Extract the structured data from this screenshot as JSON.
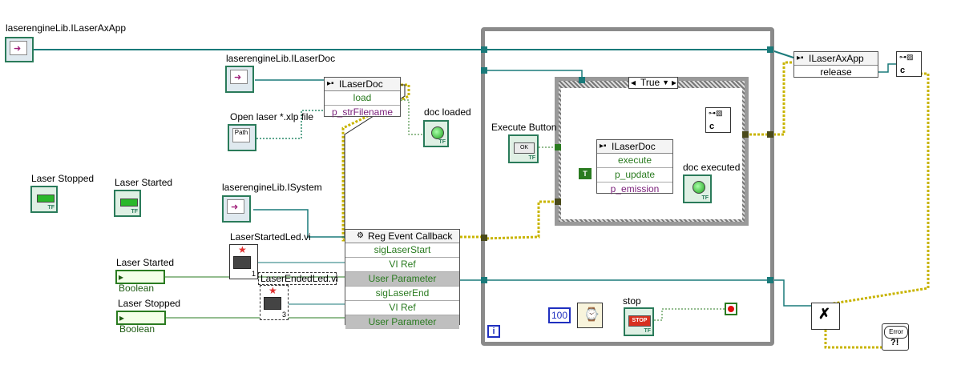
{
  "labels": {
    "app_ref": "laserengineLib.ILaserAxApp",
    "doc_ref": "laserengineLib.ILaserDoc",
    "open_file": "Open laser  *.xlp file",
    "doc_loaded": "doc loaded",
    "laser_stopped_ind": "Laser Stopped",
    "laser_started_ind": "Laser Started",
    "system_ref": "laserengineLib.ISystem",
    "started_vi": "LaserStartedLed.vi",
    "ended_vi": "LaserEndedLed.vi",
    "laser_started_ctrl": "Laser Started",
    "laser_stopped_ctrl": "Laser Stopped",
    "execute_button": "Execute Button",
    "doc_executed": "doc executed",
    "stop": "stop"
  },
  "nodes": {
    "load_node": {
      "title": "ILaserDoc",
      "rows": [
        "load",
        "p_strFilename"
      ]
    },
    "reg_event": {
      "title": "Reg Event Callback",
      "rows": [
        "sigLaserStart",
        "VI Ref",
        "User Parameter",
        "sigLaserEnd",
        "VI Ref",
        "User Parameter"
      ]
    },
    "execute_node": {
      "title": "ILaserDoc",
      "rows": [
        "execute",
        "p_update",
        "p_emission"
      ]
    },
    "release_node": {
      "title": "ILaserAxApp",
      "rows": [
        "release"
      ]
    }
  },
  "controls": {
    "boolean_1": "Boolean",
    "boolean_2": "Boolean",
    "case_selector": "True",
    "wait_ms": "100",
    "true_const": "T",
    "path_text": "Path",
    "ok_text": "OK",
    "stop_btn_text": "STOP",
    "loop_iter": "i",
    "tf": "TF",
    "subvi_started_num": "1",
    "subvi_ended_num": "3",
    "close_ref_label": "c",
    "error_label": "Error"
  },
  "colors": {
    "refnum_wire": "#1a7a7a",
    "error_wire": "#c8b400",
    "bool_wire": "#2a7b20",
    "path_wire": "#2a8a6a",
    "loop_border": "#888888"
  }
}
